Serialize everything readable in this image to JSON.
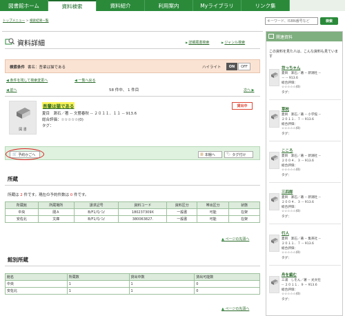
{
  "nav": {
    "tabs": [
      "図書館ホーム",
      "資料検索",
      "資料紹介",
      "利用案内",
      "Myライブラリ",
      "リンク集"
    ],
    "active_index": 1
  },
  "breadcrumb": {
    "home": "トップメニュー",
    "sep": " > ",
    "current": "検索結果一覧"
  },
  "search": {
    "placeholder": "キーワード、ISBN番号など",
    "button": "検索"
  },
  "main": {
    "title": "資料詳細",
    "link_detail_search": "詳細蔵書検索",
    "link_genre_search": "ジャンル検索",
    "condition": {
      "label": "検索条件",
      "text": "書名：吾輩は猫である",
      "highlight_label": "ハイライト",
      "on": "ON",
      "off": "OFF"
    },
    "link_narrow": "条件を残して検索変更へ",
    "link_back_list": "一覧へ戻る",
    "pager": {
      "prev": "前へ",
      "next": "次へ",
      "text": "58 件中、 1 件目"
    },
    "book": {
      "thumb_label": "図 書",
      "title": "吾輩は猫である",
      "line1": "夏目　漱石／著 -- 文藝春秋 -- ２０１１．１１ -- 913.6",
      "line2": "総合評価：☆☆☆☆☆(0)",
      "line3": "タグ：",
      "status": "貸出中"
    },
    "actions": {
      "reserve": "予約かごへ",
      "shelf": "本棚へ",
      "tag": "タグ付け"
    },
    "holdings": {
      "title": "所蔵",
      "summary_prefix": "所蔵は ",
      "count": "2",
      "summary_mid": " 件です。現在の予約件数は ",
      "reservations": "0",
      "summary_suffix": " 件です。",
      "columns": [
        "所蔵館",
        "所蔵場所",
        "請求記号",
        "資料コード",
        "資料区分",
        "帯出区分",
        "状態"
      ],
      "rows": [
        [
          "中央",
          "閲Ａ",
          "B/F1/なつ/",
          "180237309X",
          "一般書",
          "可能",
          "在架"
        ],
        [
          "安佐北",
          "文庫",
          "B/F1/なつ/",
          "380063827.",
          "一般書",
          "可能",
          "在架"
        ]
      ],
      "page_top": "ページの先頭へ"
    },
    "branch": {
      "title": "館別所蔵",
      "columns": [
        "館名",
        "所蔵数",
        "貸出中数",
        "貸出可能数"
      ],
      "rows": [
        [
          "中央",
          "1",
          "1",
          "0"
        ],
        [
          "安佐北",
          "1",
          "1",
          "0"
        ]
      ],
      "page_top": "ページの先頭へ"
    }
  },
  "sidebar": {
    "title": "関連資料",
    "intro": "この資料を見た人は、こんな資料も見ています",
    "items": [
      {
        "title": "坊っちゃん",
        "line1": "夏目　漱石／著 -- 新潮社 --",
        "line2": "－ -- 913.6",
        "line3": "総合評価：",
        "line4": "☆☆☆☆☆(0)",
        "line5": "タグ："
      },
      {
        "title": "草枕",
        "line1": "夏目　漱石／著 -- 小学館 --",
        "line2": "２０１１．７ -- 913.6",
        "line3": "総合評価：",
        "line4": "☆☆☆☆☆(0)",
        "line5": "タグ："
      },
      {
        "title": "こころ",
        "line1": "夏目　漱石／著 -- 新潮社 --",
        "line2": "２００４．３ -- 913.6",
        "line3": "総合評価：",
        "line4": "☆☆☆☆☆(0)",
        "line5": "タグ："
      },
      {
        "title": "三四郎",
        "line1": "夏目　漱石／著 -- 新潮社 --",
        "line2": "２００４．３ -- 913.6",
        "line3": "総合評価：",
        "line4": "☆☆☆☆☆(0)",
        "line5": "タグ："
      },
      {
        "title": "行人",
        "line1": "夏目　漱石／著 -- 集英社 --",
        "line2": "２０１１．７ -- 913.6",
        "line3": "総合評価：",
        "line4": "☆☆☆☆☆(0)",
        "line5": "タグ："
      },
      {
        "title": "舟を編む",
        "line1": "三浦　しをん／著 -- 光文社",
        "line2": "-- ２０１１．９ -- 913.6",
        "line3": "総合評価：",
        "line4": "☆☆☆☆☆(0)",
        "line5": "タグ："
      }
    ]
  },
  "colors": {
    "brand_green": "#2a8a3a",
    "highlight_yellow": "#fbf35a",
    "alert_red": "#d22222"
  },
  "icons": [
    "magnifier-book-icon",
    "book-icon",
    "cart-icon",
    "bookshelf-icon",
    "tag-icon"
  ]
}
